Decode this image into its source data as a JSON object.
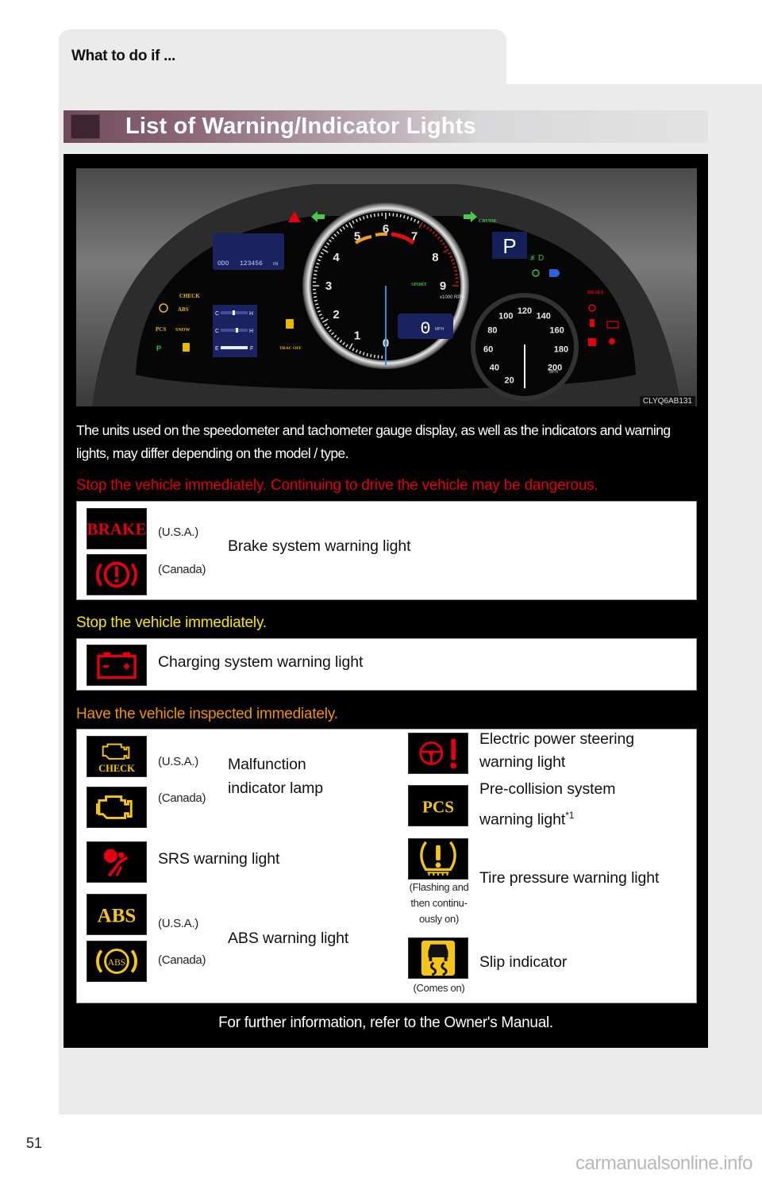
{
  "header": {
    "section_label": "What to do if ...",
    "title": "List of Warning/Indicator Lights"
  },
  "dashboard": {
    "image_id": "CLYQ6AB131",
    "odometer_label": "ODO",
    "odometer_value": "123456",
    "odometer_unit": "mi",
    "gear": "P",
    "speed_digital": "0",
    "speed_unit": "MPH",
    "tach_labels": [
      "0",
      "1",
      "2",
      "3",
      "4",
      "5",
      "6",
      "7",
      "8",
      "9"
    ],
    "tach_unit": "x1000 RPM",
    "tach_mode": "SPORT",
    "speedo_labels": [
      "20",
      "40",
      "60",
      "80",
      "100",
      "120",
      "140",
      "160",
      "180",
      "200"
    ],
    "speedo_unit": "MPH",
    "indicator_texts": {
      "check": "CHECK",
      "abs": "ABS",
      "pcs": "PCS",
      "snow": "SNOW",
      "trac_off": "TRAC OFF",
      "cruise": "CRUISE",
      "brake": "BRAKE",
      "gauge_c": "C",
      "gauge_h": "H",
      "gauge_e": "E",
      "gauge_f": "F"
    }
  },
  "intro": "The units used on the speedometer and tachometer gauge display, as well as the indicators and warning lights, may differ depending on the model / type.",
  "categories": [
    {
      "heading": "Stop the vehicle immediately. Continuing to drive the vehicle may be dangerous.",
      "color": "#e3000f",
      "items": [
        {
          "label": "Brake system warning light",
          "variants": [
            {
              "region": "(U.S.A.)",
              "icon": "brake-text-icon",
              "icon_text": "BRAKE"
            },
            {
              "region": "(Canada)",
              "icon": "brake-circle-icon"
            }
          ]
        }
      ]
    },
    {
      "heading": "Stop the vehicle immediately.",
      "color": "#f7e50a",
      "items": [
        {
          "label": "Charging system warning light",
          "icon": "battery-icon"
        }
      ]
    },
    {
      "heading": "Have the vehicle inspected immediately.",
      "color": "#f39200",
      "left_items": [
        {
          "label_line1": "Malfunction",
          "label_line2": "indicator lamp",
          "variants": [
            {
              "region": "(U.S.A.)",
              "icon": "check-engine-text-icon",
              "icon_text": "CHECK"
            },
            {
              "region": "(Canada)",
              "icon": "check-engine-icon"
            }
          ]
        },
        {
          "label": "SRS warning light",
          "icon": "airbag-icon"
        },
        {
          "label": "ABS warning light",
          "variants": [
            {
              "region": "(U.S.A.)",
              "icon": "abs-text-icon",
              "icon_text": "ABS"
            },
            {
              "region": "(Canada)",
              "icon": "abs-circle-icon",
              "icon_text": "ABS"
            }
          ]
        }
      ],
      "right_items": [
        {
          "label_line1": "Electric power steering",
          "label_line2": "warning light",
          "icon": "steering-warning-icon"
        },
        {
          "label_line1": "Pre-collision system",
          "label_line2": "warning light",
          "footnote": "*1",
          "icon": "pcs-icon",
          "icon_text": "PCS"
        },
        {
          "label": "Tire pressure warning light",
          "icon": "tire-pressure-icon",
          "note_line1": "(Flashing and",
          "note_line2": "then continu-",
          "note_line3": "ously on)"
        },
        {
          "label": "Slip indicator",
          "icon": "slip-icon",
          "note": "(Comes on)"
        }
      ]
    }
  ],
  "footer": "For further information, refer to the Owner's Manual.",
  "page_number": "51",
  "watermark": "carmanualsonline.info",
  "colors": {
    "warning_red": "#e3000f",
    "warning_yellow": "#f7e50a",
    "warning_orange": "#f39200",
    "icon_amber": "#f5c518",
    "title_accent": "#6e4a5c"
  }
}
